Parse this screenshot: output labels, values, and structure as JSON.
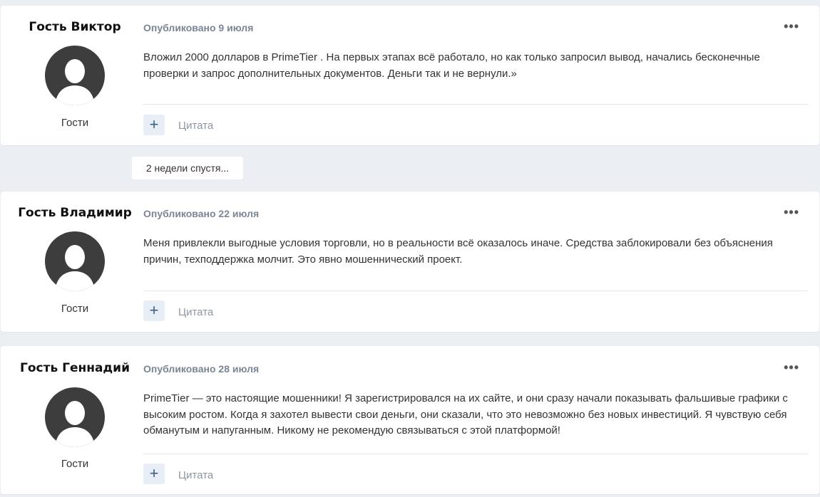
{
  "posts": [
    {
      "author": "Гость Виктор",
      "role": "Гости",
      "date": "Опубликовано 9 июля",
      "text": "Вложил 2000 долларов в PrimeTier . На первых этапах всё работало, но как только запросил вывод, начались бесконечные проверки и запрос дополнительных документов. Деньги так и не вернули.»",
      "menu": "•••",
      "plus": "+",
      "quote": "Цитата"
    },
    {
      "author": "Гость Владимир",
      "role": "Гости",
      "date": "Опубликовано 22 июля",
      "text": "Меня привлекли выгодные условия торговли, но в реальности всё оказалось иначе. Средства заблокировали без объяснения причин, техподдержка молчит. Это явно мошеннический проект.",
      "menu": "•••",
      "plus": "+",
      "quote": "Цитата"
    },
    {
      "author": "Гость Геннадий",
      "role": "Гости",
      "date": "Опубликовано 28 июля",
      "text": "PrimeTier — это настоящие мошенники! Я зарегистрировался на их сайте, и они сразу начали показывать фальшивые графики с высоким ростом. Когда я захотел вывести свои деньги, они сказали, что это невозможно без новых инвестиций. Я чувствую себя обманутым и напуганным. Никому не рекомендую связываться с этой платформой!",
      "menu": "•••",
      "plus": "+",
      "quote": "Цитата"
    }
  ],
  "time_gap": "2 недели спустя...",
  "colors": {
    "page_bg": "#ebeef2",
    "card_bg": "#ffffff",
    "date_text": "#7a8595",
    "button_bg": "#e8eef5",
    "button_icon": "#3d5f86",
    "avatar": "#3d3d3d"
  },
  "icons": {
    "avatar": "default-user-avatar-icon",
    "menu": "more-horizontal-icon",
    "plus": "plus-icon"
  }
}
